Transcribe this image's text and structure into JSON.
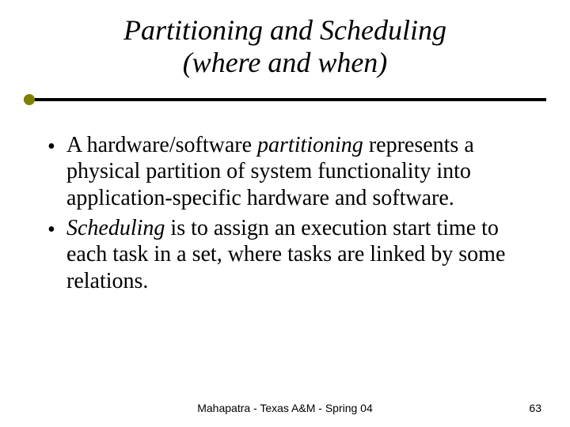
{
  "title": {
    "line1": "Partitioning and Scheduling",
    "line2": "(where and when)"
  },
  "bullets": [
    {
      "marker": "•",
      "segments": [
        {
          "text": "A hardware/software ",
          "italic": false
        },
        {
          "text": "partitioning",
          "italic": true
        },
        {
          "text": " represents a physical partition of system functionality into application-specific hardware and software.",
          "italic": false
        }
      ]
    },
    {
      "marker": "•",
      "segments": [
        {
          "text": "Scheduling",
          "italic": true
        },
        {
          "text": " is to assign an execution start time to each task in a set, where tasks are linked by some relations.",
          "italic": false
        }
      ]
    }
  ],
  "footer": {
    "center": "Mahapatra - Texas A&M - Spring 04",
    "page": "63"
  },
  "colors": {
    "accent": "#808000"
  }
}
